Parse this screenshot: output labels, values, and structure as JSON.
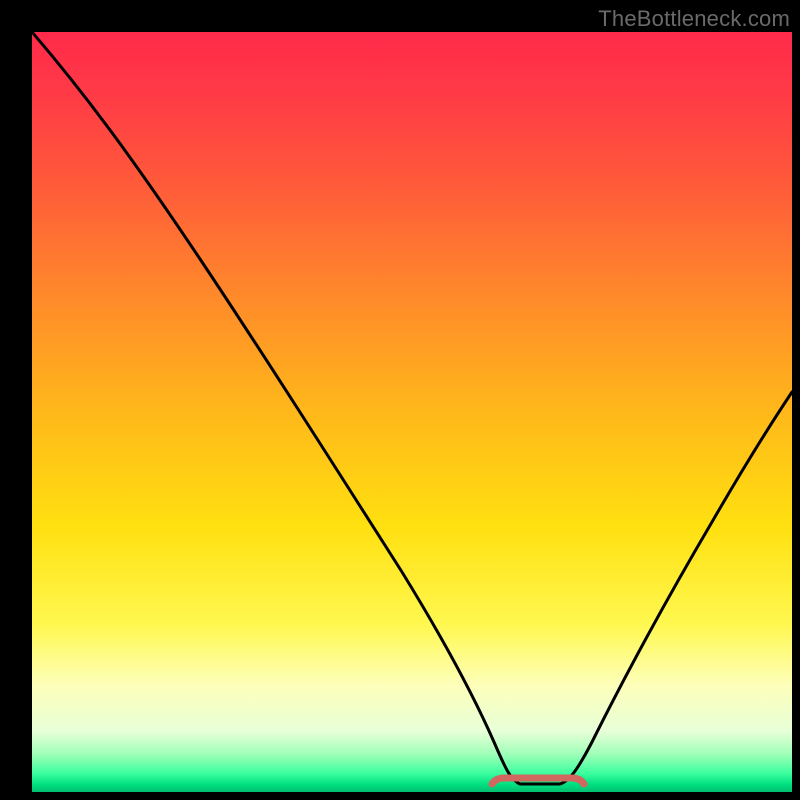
{
  "watermark": "TheBottleneck.com",
  "colors": {
    "background": "#000000",
    "curve": "#000000",
    "valley_marker": "#d1675e",
    "gradient_stops": [
      "#ff2a4a",
      "#ff3a46",
      "#ff5a3a",
      "#ff8a2a",
      "#ffb81a",
      "#ffe010",
      "#fff850",
      "#fdffba",
      "#e8ffd8",
      "#a0ffb8",
      "#3effa0",
      "#00e080",
      "#00c070"
    ]
  },
  "chart_data": {
    "type": "line",
    "title": "",
    "xlabel": "",
    "ylabel": "",
    "xlim": [
      0,
      100
    ],
    "ylim": [
      0,
      100
    ],
    "x": [
      0,
      5,
      10,
      15,
      20,
      25,
      30,
      35,
      40,
      45,
      50,
      55,
      58,
      60,
      62,
      64,
      66,
      68,
      70,
      75,
      80,
      85,
      90,
      95,
      100
    ],
    "values": [
      100,
      91,
      82,
      73,
      64,
      56,
      48,
      40,
      32,
      24,
      16,
      8,
      3,
      1.2,
      0.6,
      0.5,
      0.5,
      0.6,
      1.5,
      6,
      13,
      21,
      30,
      40,
      50
    ],
    "valley": {
      "x_start": 60,
      "x_end": 70,
      "y": 0.5
    },
    "annotations": [
      "TheBottleneck.com"
    ]
  }
}
